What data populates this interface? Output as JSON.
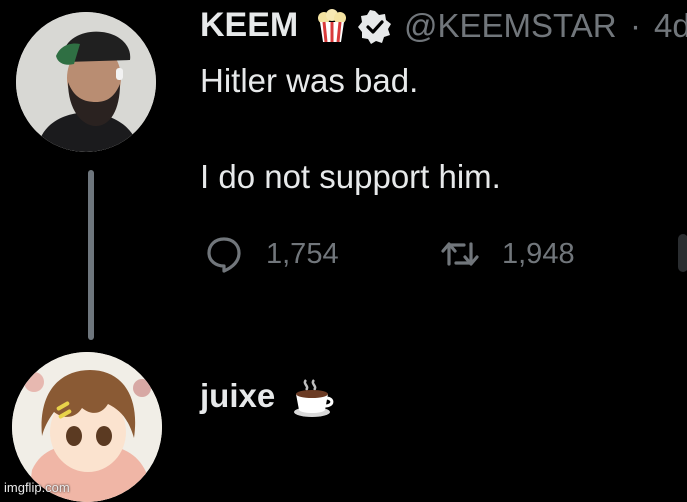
{
  "tweet": {
    "author_name": "KEEM",
    "author_emoji": "popcorn-emoji",
    "handle": "@KEEMSTAR",
    "separator": "·",
    "time": "4d",
    "text_line1": "Hitler was bad.",
    "text_line2": "I do not support him.",
    "reply_count": "1,754",
    "retweet_count": "1,948"
  },
  "reply": {
    "author_name": "juixe",
    "author_emoji": "hot-beverage-emoji"
  },
  "watermark": "imgflip.com",
  "colors": {
    "background": "#000000",
    "primary_text": "#e7e9ea",
    "secondary_text": "#71767b",
    "verified": "#e7e9ea",
    "thread_line": "#6e767d"
  }
}
